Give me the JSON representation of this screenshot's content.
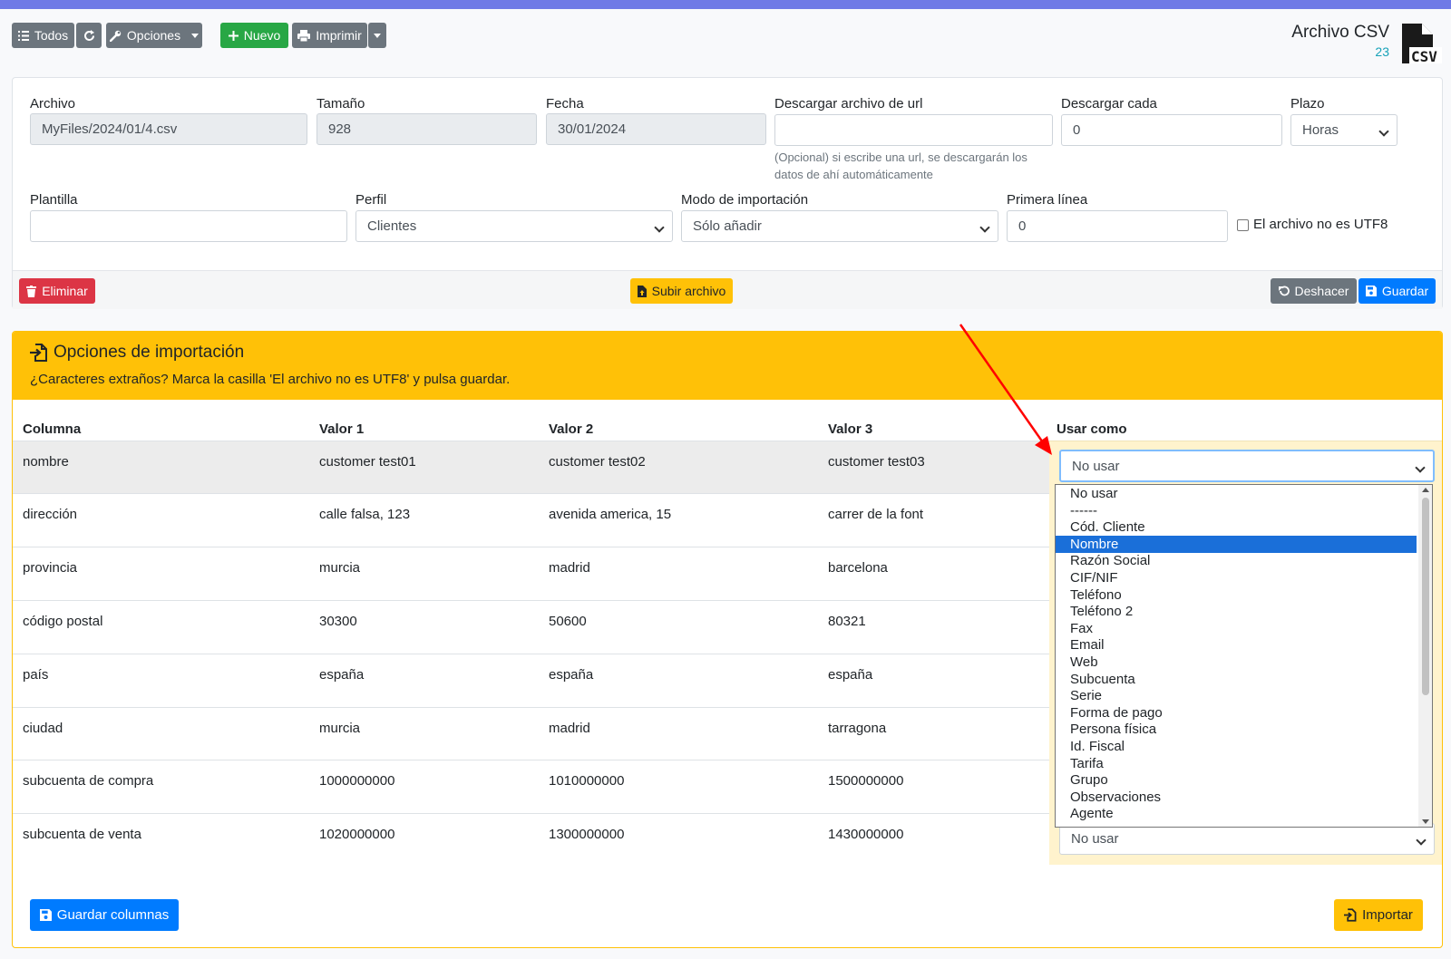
{
  "toolbar": {
    "all_label": "Todos",
    "options_label": "Opciones",
    "new_label": "Nuevo",
    "print_label": "Imprimir"
  },
  "page": {
    "title": "Archivo CSV",
    "count": "23",
    "logo_text": "CSV"
  },
  "form": {
    "file_label": "Archivo",
    "file_value": "MyFiles/2024/01/4.csv",
    "size_label": "Tamaño",
    "size_value": "928",
    "date_label": "Fecha",
    "date_value": "30/01/2024",
    "url_label": "Descargar archivo de url",
    "url_value": "",
    "url_help_1": "(Opcional) si escribe una url, se descargarán los",
    "url_help_2": "datos de ahí automáticamente",
    "every_label": "Descargar cada",
    "every_value": "0",
    "term_label": "Plazo",
    "term_value": "Horas",
    "template_label": "Plantilla",
    "template_value": "",
    "profile_label": "Perfil",
    "profile_value": "Clientes",
    "mode_label": "Modo de importación",
    "mode_value": "Sólo añadir",
    "first_line_label": "Primera línea",
    "first_line_value": "0",
    "utf8_label": "El archivo no es UTF8"
  },
  "actions": {
    "delete_label": "Eliminar",
    "upload_label": "Subir archivo",
    "undo_label": "Deshacer",
    "save_label": "Guardar"
  },
  "import": {
    "title": "Opciones de importación",
    "subtitle": "¿Caracteres extraños? Marca la casilla 'El archivo no es UTF8' y pulsa guardar.",
    "headers": [
      "Columna",
      "Valor 1",
      "Valor 2",
      "Valor 3",
      "Usar como"
    ],
    "rows": [
      [
        "nombre",
        "customer test01",
        "customer test02",
        "customer test03"
      ],
      [
        "dirección",
        "calle falsa, 123",
        "avenida america, 15",
        "carrer de la font"
      ],
      [
        "provincia",
        "murcia",
        "madrid",
        "barcelona"
      ],
      [
        "código postal",
        "30300",
        "50600",
        "80321"
      ],
      [
        "país",
        "españa",
        "españa",
        "españa"
      ],
      [
        "ciudad",
        "murcia",
        "madrid",
        "tarragona"
      ],
      [
        "subcuenta de compra",
        "1000000000",
        "1010000000",
        "1500000000"
      ],
      [
        "subcuenta de venta",
        "1020000000",
        "1300000000",
        "1430000000"
      ]
    ],
    "use_as_first": "No usar",
    "use_as_last": "No usar",
    "save_columns_label": "Guardar columnas",
    "import_label": "Importar"
  },
  "dropdown": {
    "options": [
      "No usar",
      "------",
      "Cód. Cliente",
      "Nombre",
      "Razón Social",
      "CIF/NIF",
      "Teléfono",
      "Teléfono 2",
      "Fax",
      "Email",
      "Web",
      "Subcuenta",
      "Serie",
      "Forma de pago",
      "Persona física",
      "Id. Fiscal",
      "Tarifa",
      "Grupo",
      "Observaciones",
      "Agente"
    ],
    "highlighted": "Nombre"
  },
  "colors": {
    "top_bar": "#6f7ae6",
    "secondary": "#6c757d",
    "success": "#28a745",
    "danger": "#dc3545",
    "warning": "#ffc107",
    "primary": "#007bff",
    "annotation_arrow": "#ff0000"
  }
}
